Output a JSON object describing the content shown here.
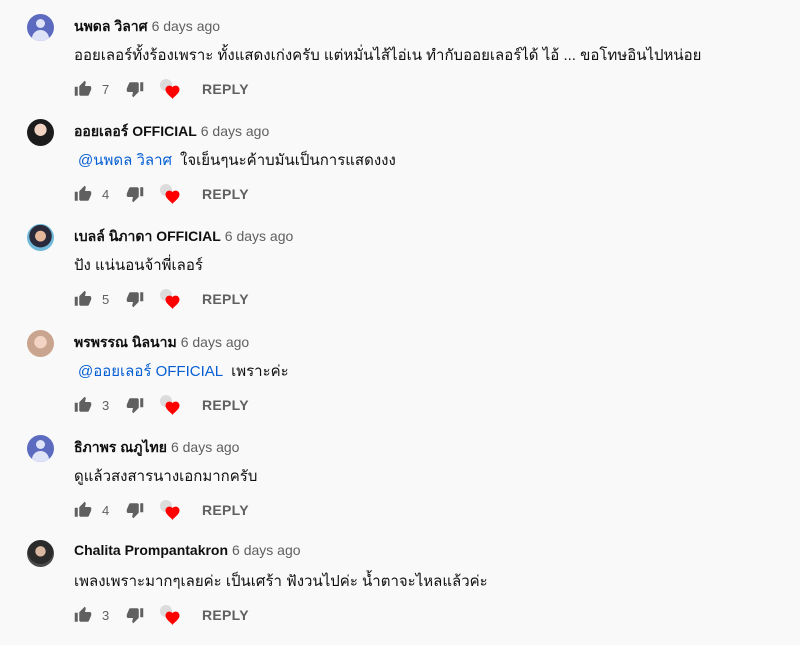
{
  "comments": [
    {
      "author": "นพดล วิลาศ",
      "time": "6 days ago",
      "mention": "",
      "text": "ออยเลอร์ทั้งร้องเพราะ ทั้งแสดงเก่งครับ แต่หมั่นไส้ไอ่เน ทำกับออยเลอร์ได้ ไอ้ ... ขอโทษอินไปหน่อย",
      "likes": "7",
      "reply_label": "REPLY",
      "avatar": "default"
    },
    {
      "author": "ออยเลอร์ OFFICIAL",
      "time": "6 days ago",
      "mention": "@นพดล วิลาศ",
      "text": "ใจเย็นๆนะค้าบมันเป็นการแสดงงง",
      "likes": "4",
      "reply_label": "REPLY",
      "avatar": "photo1"
    },
    {
      "author": "เบลล์ นิภาดา OFFICIAL",
      "time": "6 days ago",
      "mention": "",
      "text": "ปัง แน่นอนจ้าพี่เลอร์",
      "likes": "5",
      "reply_label": "REPLY",
      "avatar": "photo2"
    },
    {
      "author": "พรพรรณ นิลนาม",
      "time": "6 days ago",
      "mention": "@ออยเลอร์ OFFICIAL",
      "text": "เพราะค่ะ",
      "likes": "3",
      "reply_label": "REPLY",
      "avatar": "photo3"
    },
    {
      "author": "ธิภาพร ณภูไทย",
      "time": "6 days ago",
      "mention": "",
      "text": "ดูแล้วสงสารนางเอกมากครับ",
      "likes": "4",
      "reply_label": "REPLY",
      "avatar": "default"
    },
    {
      "author": "Chalita Prompantakron",
      "time": "6 days ago",
      "mention": "",
      "text": "เพลงเพราะมากๆเลยค่ะ เป็นเศร้า ฟังวนไปค่ะ น้ำตาจะไหลแล้วค่ะ",
      "likes": "3",
      "reply_label": "REPLY",
      "avatar": "photo4"
    }
  ],
  "icons": {
    "like": "thumbs-up-icon",
    "dislike": "thumbs-down-icon",
    "creator_heart": "creator-heart-icon"
  },
  "colors": {
    "mention": "#065fd4",
    "heart": "#ff0000"
  }
}
